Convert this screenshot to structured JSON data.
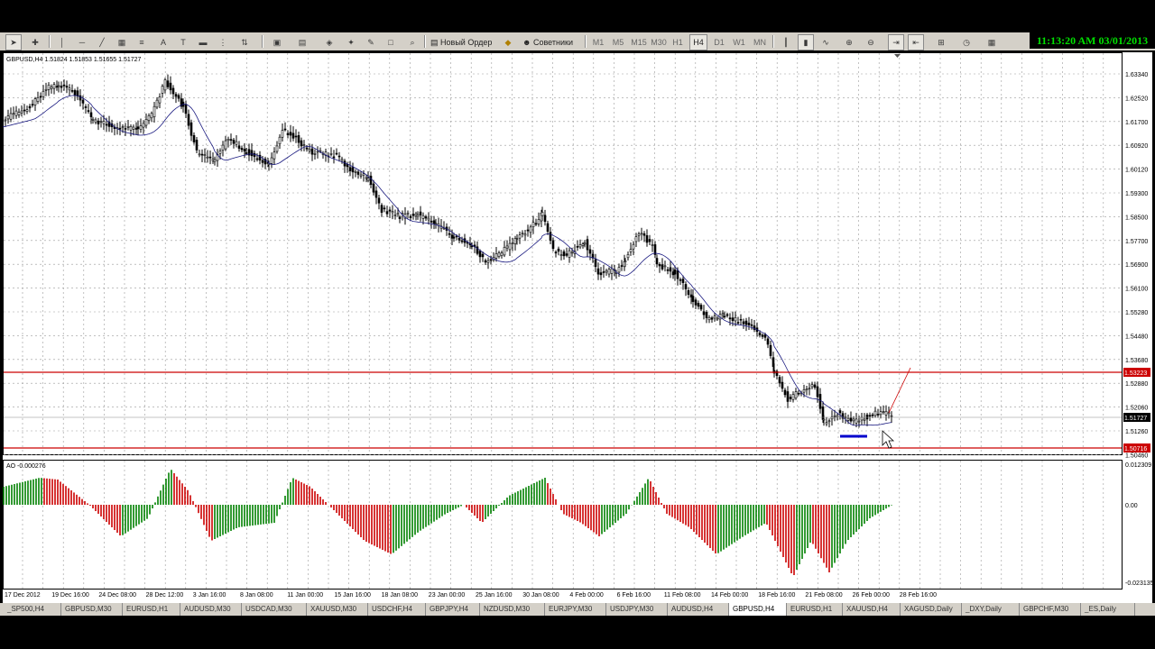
{
  "clock": "11:13:20 AM 03/01/2013",
  "toolbar": {
    "new_order_label": "Новый Ордер",
    "experts_label": "Советники",
    "timeframes": [
      "M1",
      "M5",
      "M15",
      "M30",
      "H1",
      "H4",
      "D1",
      "W1",
      "MN"
    ],
    "active_timeframe": "H4"
  },
  "chart": {
    "header": "GBPUSD,H4  1.51824 1.51853 1.51655 1.51727",
    "price_ticks": [
      "1.63340",
      "1.62520",
      "1.61700",
      "1.60920",
      "1.60120",
      "1.59300",
      "1.58500",
      "1.57700",
      "1.56900",
      "1.56100",
      "1.55280",
      "1.54480",
      "1.53680",
      "1.52880",
      "1.52060",
      "1.51260",
      "1.50460"
    ],
    "price_markers": {
      "upper_line": "1.53223",
      "current": "1.51727",
      "lower_line": "1.50716"
    },
    "date_ticks": [
      "17 Dec 2012",
      "19 Dec 16:00",
      "24 Dec 08:00",
      "28 Dec 12:00",
      "3 Jan 16:00",
      "8 Jan 08:00",
      "11 Jan 00:00",
      "15 Jan 16:00",
      "18 Jan 08:00",
      "23 Jan 00:00",
      "25 Jan 16:00",
      "30 Jan 08:00",
      "4 Feb 00:00",
      "6 Feb 16:00",
      "11 Feb 08:00",
      "14 Feb 00:00",
      "18 Feb 16:00",
      "21 Feb 08:00",
      "26 Feb 00:00",
      "28 Feb 16:00"
    ],
    "ao_label": "AO -0.000276",
    "ao_ticks": {
      "top": "0.012309",
      "zero": "0.00",
      "bottom": "-0.023135"
    },
    "colors": {
      "bull_candle": "#000000",
      "ma_line": "#1a1a80",
      "level_line": "#cc0000",
      "ao_up": "#008000",
      "ao_down": "#cc0000",
      "marker_blue": "#0000cc"
    }
  },
  "tabs": [
    "_SP500,H4",
    "GBPUSD,M30",
    "EURUSD,H1",
    "AUDUSD,M30",
    "USDCAD,M30",
    "XAUUSD,M30",
    "USDCHF,H4",
    "GBPJPY,H4",
    "NZDUSD,M30",
    "EURJPY,M30",
    "USDJPY,M30",
    "AUDUSD,H4",
    "GBPUSD,H4",
    "EURUSD,H1",
    "XAUUSD,H4",
    "XAGUSD,Daily",
    "_DXY,Daily",
    "GBPCHF,M30",
    "_ES,Daily"
  ],
  "active_tab": "GBPUSD,H4"
}
